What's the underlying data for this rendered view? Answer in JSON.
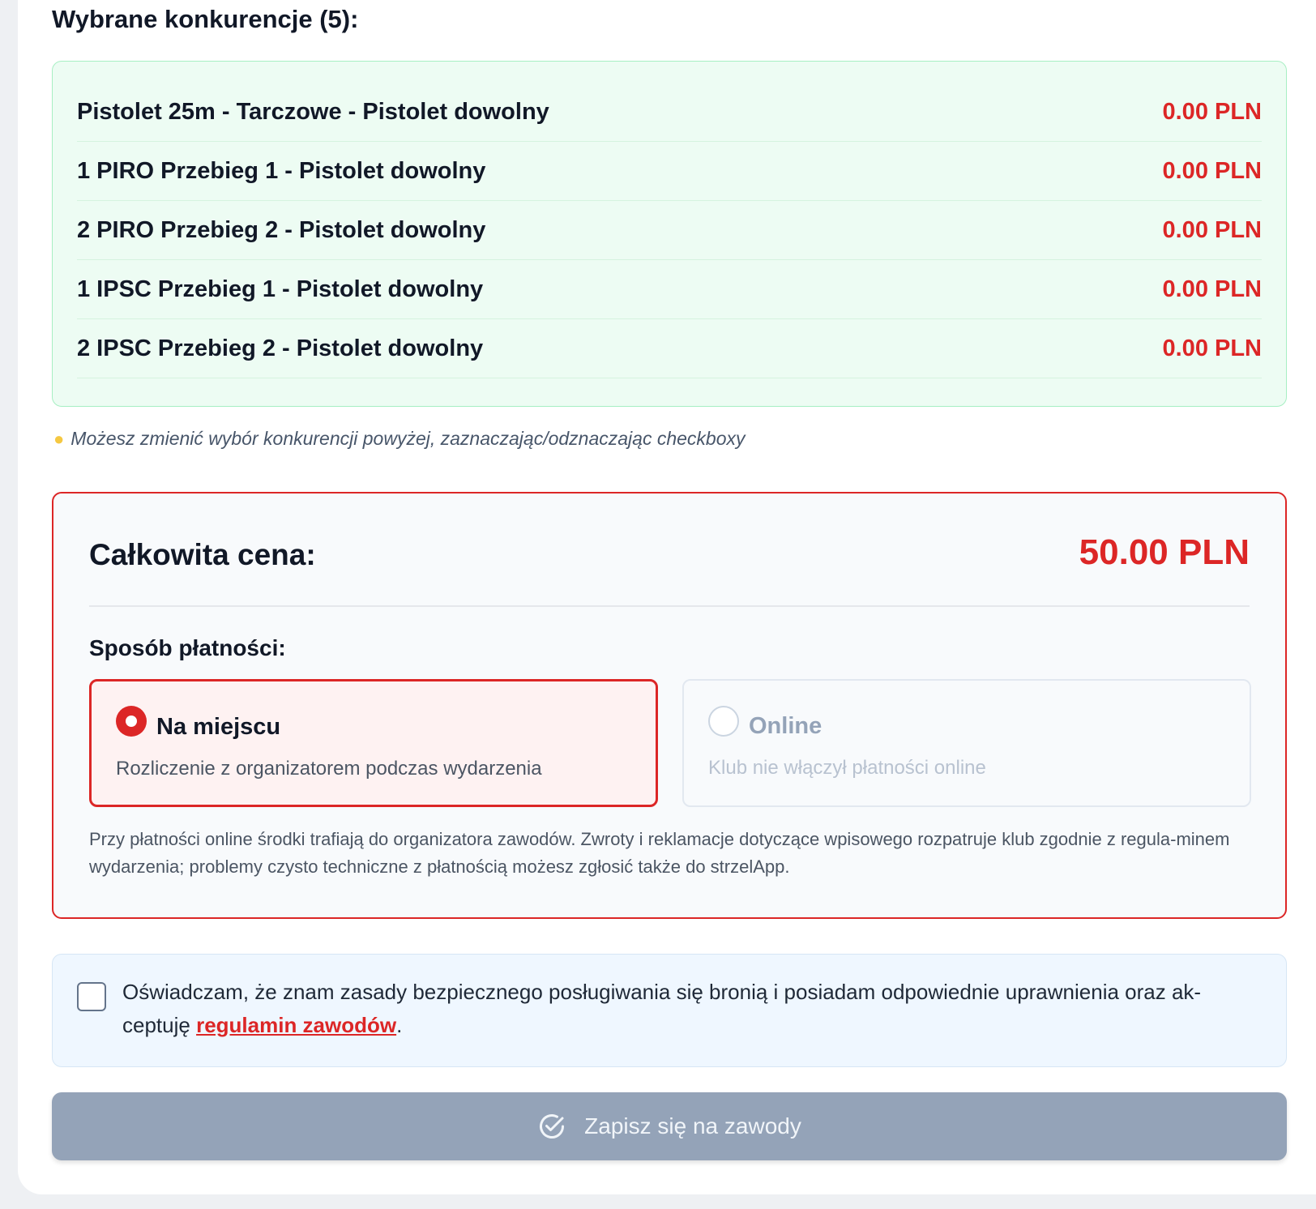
{
  "section": {
    "title": "Wybrane konkurencje (5):"
  },
  "competitions": [
    {
      "name": "Pistolet 25m - Tarczowe - Pistolet dowolny",
      "price": "0.00 PLN"
    },
    {
      "name": "1 PIRO Przebieg 1 - Pistolet dowolny",
      "price": "0.00 PLN"
    },
    {
      "name": "2 PIRO Przebieg 2 - Pistolet dowolny",
      "price": "0.00 PLN"
    },
    {
      "name": "1 IPSC Przebieg 1 - Pistolet dowolny",
      "price": "0.00 PLN"
    },
    {
      "name": "2 IPSC Przebieg 2 - Pistolet dowolny",
      "price": "0.00 PLN"
    }
  ],
  "hint": {
    "icon": "lightbulb-icon",
    "text": "Możesz zmienić wybór konkurencji powyżej, zaznaczając/odznaczając checkboxy"
  },
  "price": {
    "label": "Całkowita cena:",
    "value": "50.00 PLN"
  },
  "payment": {
    "label": "Sposób płatności:",
    "options": [
      {
        "title": "Na miejscu",
        "description": "Rozliczenie z organizatorem podczas wydarzenia",
        "selected": true,
        "enabled": true
      },
      {
        "title": "Online",
        "description": "Klub nie włączył płatności online",
        "selected": false,
        "enabled": false
      }
    ],
    "note": "Przy płatności online środki trafiają do organizatora zawodów. Zwroty i reklamacje dotyczące wpisowego rozpatruje klub zgodnie z regula-minem wydarzenia; problemy czysto techniczne z płatnością możesz zgłosić także do strzelApp."
  },
  "consent": {
    "checked": false,
    "text_before": "Oświadczam, że znam zasady bezpiecznego posługiwania się bronią i posiadam odpowiednie uprawnienia oraz ak-ceptuję ",
    "link_text": "regulamin zawodów",
    "text_after": "."
  },
  "submit": {
    "label": "Zapisz się na zawody",
    "icon": "check-circle-icon",
    "enabled": false
  },
  "colors": {
    "accent_red": "#dc2626",
    "success_bg": "#edfcf3",
    "disabled_button": "#94a3b8"
  }
}
